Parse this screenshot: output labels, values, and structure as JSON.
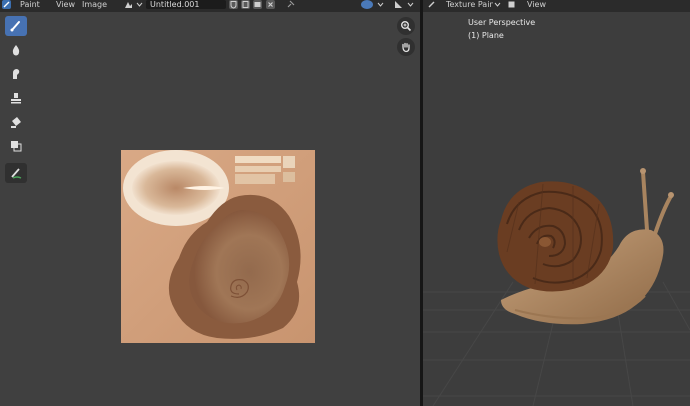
{
  "image_editor": {
    "header": {
      "mode_label": "Paint",
      "menus": [
        "View",
        "Image"
      ],
      "image_name": "Untitled.001"
    },
    "tools": [
      {
        "name": "draw-brush",
        "icon": "brush-icon",
        "active": true
      },
      {
        "name": "soften",
        "icon": "drop-icon",
        "active": false
      },
      {
        "name": "smear",
        "icon": "smear-icon",
        "active": false
      },
      {
        "name": "clone",
        "icon": "stamp-icon",
        "active": false
      },
      {
        "name": "fill",
        "icon": "bucket-icon",
        "active": false
      },
      {
        "name": "mask",
        "icon": "mask-icon",
        "active": false
      },
      {
        "name": "annotate",
        "icon": "annotate-icon",
        "active": false
      }
    ],
    "nav_icons": [
      "zoom-icon",
      "hand-icon"
    ]
  },
  "viewport": {
    "header": {
      "mode_label": "Texture Paint",
      "menus": [
        "View"
      ]
    },
    "overlay": {
      "perspective": "User Perspective",
      "object": "(1) Plane"
    },
    "colors": {
      "shell_dark": "#4a2a18",
      "shell_mid": "#6b3e22",
      "body": "#b08a63",
      "grid": "#474747",
      "accent": "#4772b3"
    }
  }
}
